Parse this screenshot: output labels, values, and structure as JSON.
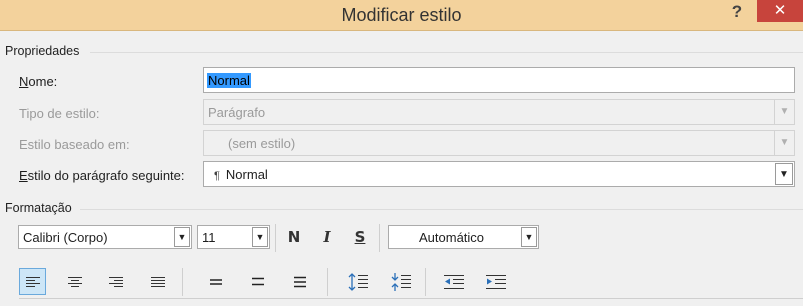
{
  "window": {
    "title": "Modificar estilo",
    "help": "?",
    "minimize": "–",
    "close": "✕"
  },
  "properties": {
    "section": "Propriedades",
    "name": {
      "label_u": "N",
      "label_rest": "ome:",
      "value": "Normal"
    },
    "style_type": {
      "label": "Tipo de estilo:",
      "value": "Parágrafo"
    },
    "based_on": {
      "label": "Estilo baseado em:",
      "value": "(sem estilo)"
    },
    "next": {
      "label_u": "E",
      "label_rest": "stilo do parágrafo seguinte:",
      "pilcrow": "¶",
      "value": "Normal"
    }
  },
  "formatting": {
    "section": "Formatação",
    "font": "Calibri (Corpo)",
    "size": "11",
    "bold": "N",
    "italic": "I",
    "underline": "S",
    "color": "Automático"
  },
  "paragraph_tools": [
    "align-left",
    "align-center",
    "align-right",
    "justify",
    "single-spacing",
    "one-half-spacing",
    "double-spacing",
    "increase-paragraph-spacing",
    "decrease-paragraph-spacing",
    "decrease-indent",
    "increase-indent"
  ],
  "colors": {
    "title_bar": "#f3d29c",
    "close_button": "#c7443c",
    "selection": "#3399ff",
    "active_button": "#cde6f7"
  }
}
